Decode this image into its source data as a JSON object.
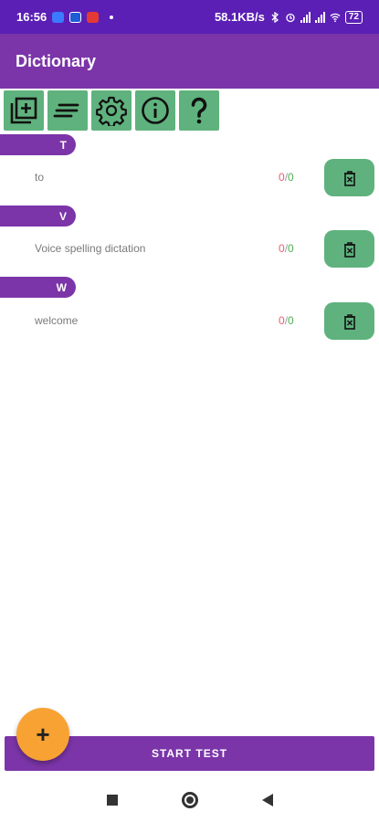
{
  "status_bar": {
    "time": "16:56",
    "network_speed": "58.1KB/s",
    "battery": "72",
    "icons": [
      "app-icon-1",
      "app-icon-2",
      "youtube-icon",
      "bluetooth-icon",
      "alarm-icon",
      "signal-icon",
      "signal-icon",
      "wifi-icon",
      "battery-icon"
    ]
  },
  "app_bar": {
    "title": "Dictionary"
  },
  "toolbar": {
    "buttons": [
      {
        "icon": "add-library-icon"
      },
      {
        "icon": "sort-lines-icon"
      },
      {
        "icon": "gear-icon"
      },
      {
        "icon": "info-icon"
      },
      {
        "icon": "help-icon",
        "glyph": "?"
      }
    ]
  },
  "sections": [
    {
      "letter": "T",
      "words": [
        {
          "text": "to",
          "wrong": "0",
          "sep": "/",
          "right": "0"
        }
      ]
    },
    {
      "letter": "V",
      "words": [
        {
          "text": "Voice spelling dictation",
          "wrong": "0",
          "sep": "/",
          "right": "0"
        }
      ]
    },
    {
      "letter": "W",
      "words": [
        {
          "text": "welcome",
          "wrong": "0",
          "sep": "/",
          "right": "0"
        }
      ]
    }
  ],
  "start_button": {
    "label": "START TEST"
  },
  "fab": {
    "glyph": "+"
  },
  "colors": {
    "status_bar": "#5b1fb5",
    "primary": "#7b35a8",
    "button_green": "#5fb27d",
    "fab_orange": "#f7a233",
    "score_wrong": "#ef5a6f",
    "score_right": "#4caf50"
  }
}
